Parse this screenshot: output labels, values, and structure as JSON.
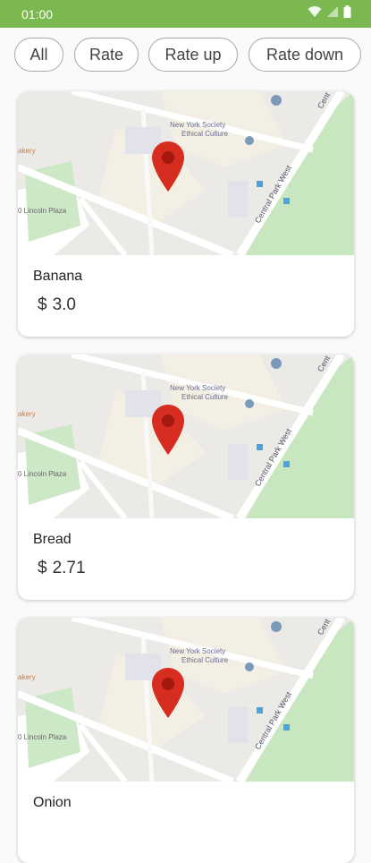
{
  "status": {
    "time": "01:00"
  },
  "filters": [
    {
      "label": "All"
    },
    {
      "label": "Rate"
    },
    {
      "label": "Rate up"
    },
    {
      "label": "Rate down"
    }
  ],
  "map": {
    "labels": {
      "society_line1": "New York Society",
      "society_line2": "Ethical Culture",
      "park": "Central Park West",
      "plaza": "0 Lincoln Plaza",
      "bakery": "akery",
      "cent": "Cent"
    },
    "colors": {
      "pin": "#d62d20",
      "park": "#c8e6c0",
      "road": "#ffffff",
      "block": "#f3efe4"
    }
  },
  "products": [
    {
      "name": "Banana",
      "currency": "$",
      "price": "3.0"
    },
    {
      "name": "Bread",
      "currency": "$",
      "price": "2.71"
    },
    {
      "name": "Onion",
      "currency": "$",
      "price": ""
    }
  ]
}
